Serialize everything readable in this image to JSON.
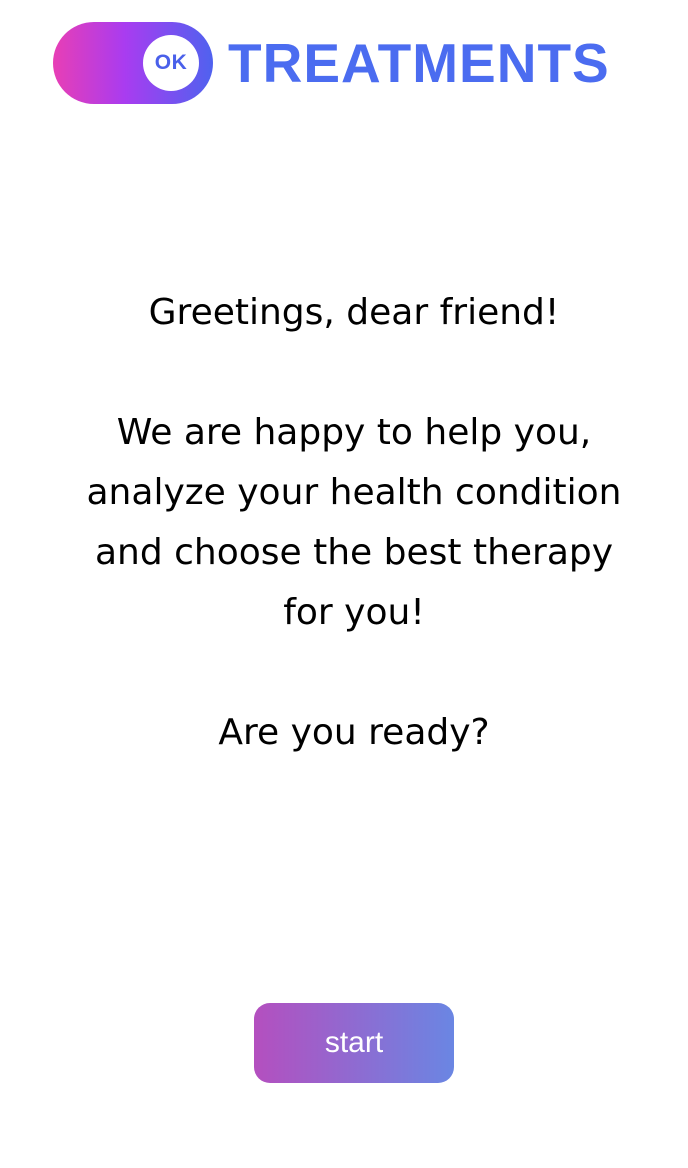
{
  "brand": {
    "badge": "OK",
    "name": "TREATMENTS",
    "colors": {
      "pill_start": "#e83eb5",
      "pill_end": "#4f62ef",
      "wordmark": "#4b6cf0"
    }
  },
  "message": {
    "greeting": "Greetings, dear friend!",
    "intro_line1": "We are happy to help you,",
    "intro_line2": "analyze your health condition",
    "intro_line3": "and choose the best therapy",
    "intro_line4": "for you!",
    "question": "Are you ready?"
  },
  "actions": {
    "start_label": "start",
    "button_colors": {
      "start": "#b44fbf",
      "end": "#6a86e3"
    }
  }
}
